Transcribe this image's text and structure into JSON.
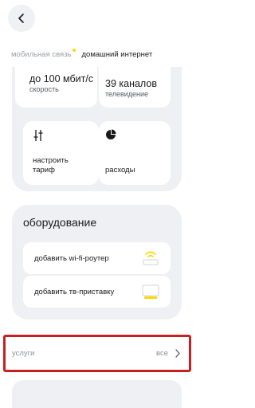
{
  "header": {
    "back_icon": "chevron-left-icon"
  },
  "tabs": [
    {
      "label": "мобильная связь"
    },
    {
      "label": "домашний интернет"
    }
  ],
  "colors": {
    "accent": "#ffd600",
    "highlight_border": "#c62020",
    "panel_bg": "#eef0f4"
  },
  "summary": {
    "speed_value": "до 100 мбит/с",
    "speed_label": "скорость",
    "tv_value": "39 каналов",
    "tv_label": "телевидение",
    "tariff_label": "настроить тариф",
    "tariff_icon": "sliders-icon",
    "expenses_label": "расходы",
    "expenses_icon": "pie-chart-icon"
  },
  "equipment": {
    "title": "оборудование",
    "items": [
      {
        "label": "добавить wi-fi-роутер",
        "icon": "router-icon"
      },
      {
        "label": "добавить тв-приставку",
        "icon": "tv-box-icon"
      }
    ]
  },
  "services": {
    "label": "услуги",
    "all_label": "все"
  }
}
